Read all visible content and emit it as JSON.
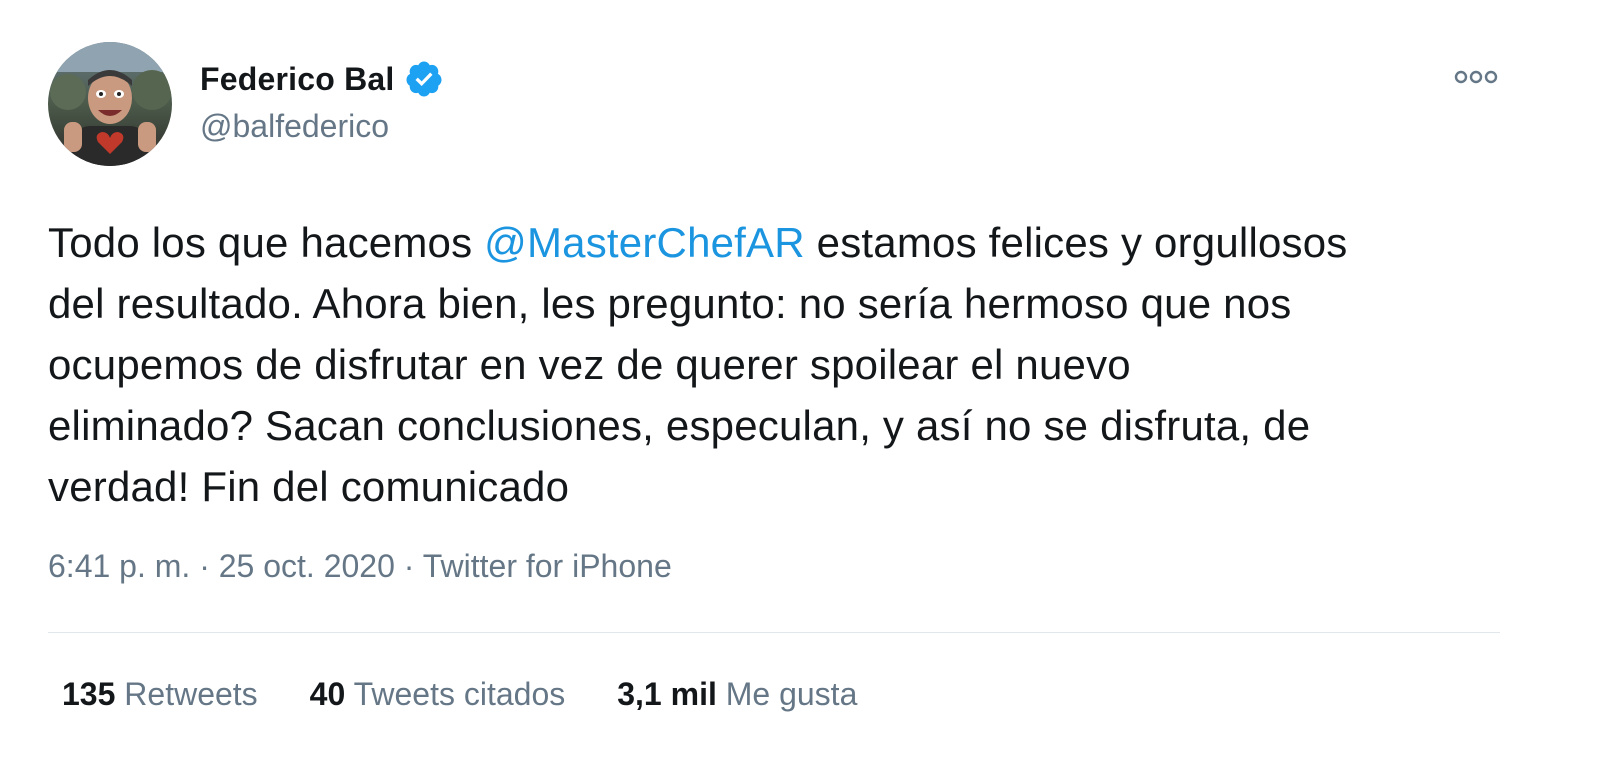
{
  "author": {
    "display_name": "Federico Bal",
    "handle": "@balfederico",
    "verified_icon": "verified-badge-icon"
  },
  "more_icon": "more-options-icon",
  "tweet": {
    "lines": [
      {
        "before": "Todo los que hacemos ",
        "mention": "@MasterChefAR",
        "after": " estamos felices y orgullosos"
      },
      {
        "text": "del resultado. Ahora bien, les pregunto: no sería hermoso que nos"
      },
      {
        "text": "ocupemos de disfrutar en vez de querer spoilear el nuevo"
      },
      {
        "text": "eliminado? Sacan conclusiones, especulan, y así no se disfruta, de"
      },
      {
        "text": "verdad! Fin del comunicado"
      }
    ]
  },
  "meta": {
    "time": "6:41 p. m.",
    "separator": " · ",
    "date": "25 oct. 2020",
    "source": "Twitter for iPhone"
  },
  "stats": {
    "retweets": {
      "count": "135",
      "label": "Retweets"
    },
    "quotes": {
      "count": "40",
      "label": "Tweets citados"
    },
    "likes": {
      "count": "3,1 mil",
      "label": "Me gusta"
    }
  },
  "colors": {
    "link": "#1b95e0",
    "secondary_text": "#657786",
    "primary_text": "#14171a",
    "verified": "#1da1f2",
    "divider": "#e1e8ed"
  }
}
